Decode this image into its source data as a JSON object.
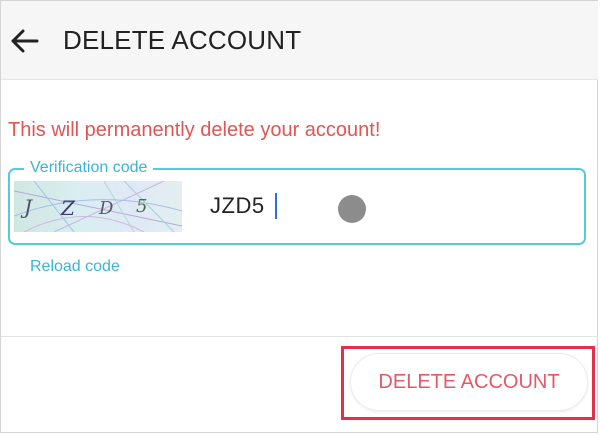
{
  "header": {
    "title": "DELETE ACCOUNT",
    "back_icon": "arrow-left-icon"
  },
  "warning": {
    "text": "This will permanently delete your account!",
    "color": "#e25555"
  },
  "verification": {
    "label": "Verification code",
    "captcha_chars": [
      "J",
      "Z",
      "D",
      "5"
    ],
    "input_value": "JZD5",
    "reload_label": "Reload code",
    "accent_color": "#3bb4d2"
  },
  "footer": {
    "delete_label": "DELETE ACCOUNT",
    "highlight_color": "#e1314a"
  }
}
